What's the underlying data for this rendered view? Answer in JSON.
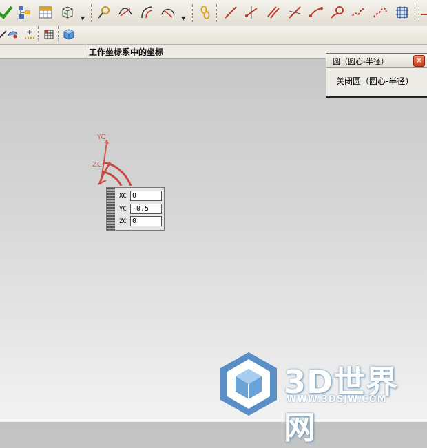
{
  "cue_line": {
    "text": "工作坐标系中的坐标"
  },
  "dialog": {
    "title": "圆（圆心-半径）",
    "close_label": "×",
    "option": "关闭圆（圆心-半径）"
  },
  "coordinates": {
    "xc": {
      "label": "XC",
      "value": "0"
    },
    "yc": {
      "label": "YC",
      "value": "-0.5"
    },
    "zc": {
      "label": "ZC",
      "value": "0"
    }
  },
  "axes": {
    "yc_label": "YC",
    "zc_label": "ZC"
  },
  "watermark": {
    "brand": "3D世界网",
    "url": "WWW.3DSJW.COM"
  },
  "toolbar": {
    "row1_icons": [
      "checkmark-icon",
      "assembly-tree-icon",
      "table-icon",
      "orient-view-icon",
      "inspect-icon",
      "curve-tool-a-icon",
      "curve-tool-b-icon",
      "curve-tool-c-icon",
      "chain-link-icon",
      "line-icon",
      "line-points-icon",
      "parallel-lines-icon",
      "cross-lines-icon",
      "arc-icon",
      "circle-curve-icon",
      "spline-icon",
      "spline-points-icon",
      "rectangle-grid-icon"
    ],
    "row2_icons": [
      "pencil-icon",
      "point-icon",
      "grid-icon",
      "cube-icon"
    ]
  },
  "colors": {
    "axis": "#d4584f",
    "dialog_close": "#d6502c"
  }
}
